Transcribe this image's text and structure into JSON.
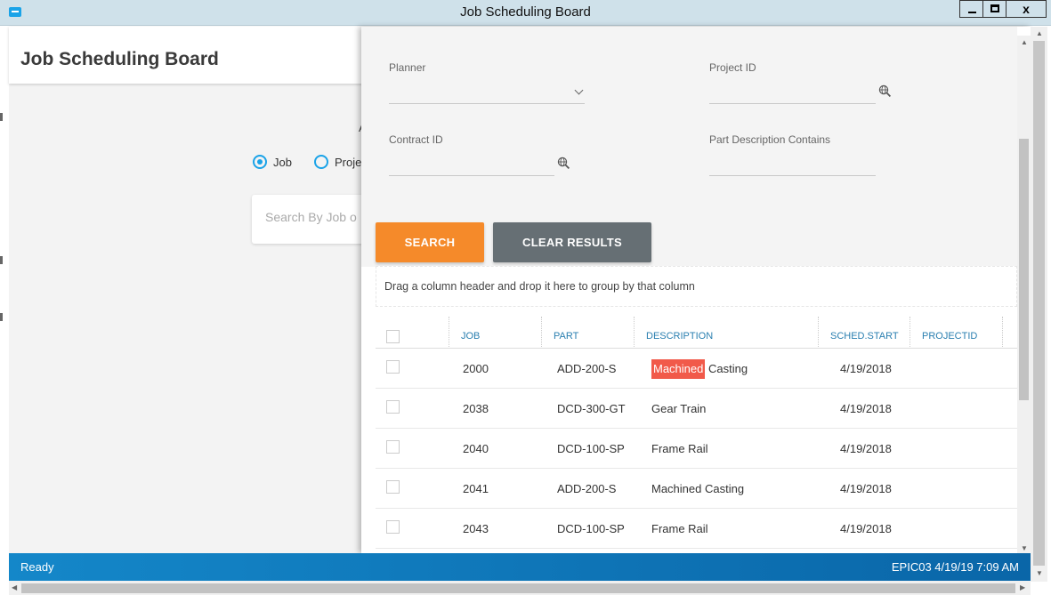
{
  "window": {
    "title": "Job Scheduling Board",
    "close_glyph": "x"
  },
  "app": {
    "title": "Job Scheduling Board",
    "partial_text": "A",
    "radio_options": [
      "Job",
      "Proje"
    ],
    "search_placeholder": "Search By Job o"
  },
  "filters": {
    "planner_label": "Planner",
    "project_id_label": "Project ID",
    "contract_id_label": "Contract ID",
    "part_desc_label": "Part Description Contains"
  },
  "buttons": {
    "search": "SEARCH",
    "clear": "CLEAR RESULTS"
  },
  "group_hint": "Drag a column header and drop it here to group by that column",
  "grid": {
    "columns": [
      "JOB",
      "PART",
      "DESCRIPTION",
      "SCHED.START",
      "PROJECTID"
    ],
    "rows": [
      {
        "job": "2000",
        "part": "ADD-200-S",
        "desc_hl": "Machined",
        "desc_rest": " Casting",
        "start": "4/19/2018"
      },
      {
        "job": "2038",
        "part": "DCD-300-GT",
        "desc": "Gear Train",
        "start": "4/19/2018"
      },
      {
        "job": "2040",
        "part": "DCD-100-SP",
        "desc": "Frame Rail",
        "start": "4/19/2018"
      },
      {
        "job": "2041",
        "part": "ADD-200-S",
        "desc": "Machined Casting",
        "start": "4/19/2018"
      },
      {
        "job": "2043",
        "part": "DCD-100-SP",
        "desc": "Frame Rail",
        "start": "4/19/2018"
      }
    ]
  },
  "status": {
    "left": "Ready",
    "right": "EPIC03 4/19/19 7:09 AM"
  },
  "icons": [
    "app-icon",
    "chevron-down-icon",
    "globe-search-icon",
    "scroll-arrow-icon"
  ],
  "colors": {
    "accent_blue": "#1aa3e8",
    "search_orange": "#f58a2a",
    "clear_gray": "#666f74",
    "highlight_red": "#f15a4a",
    "status_blue": "#1487c9"
  }
}
